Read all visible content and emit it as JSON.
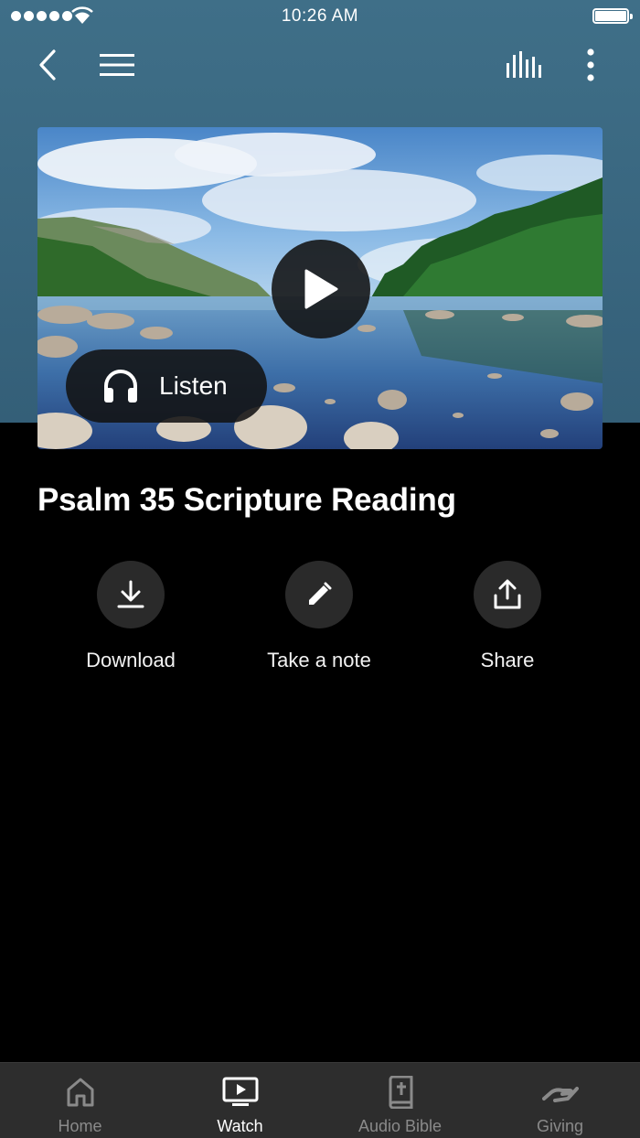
{
  "status_bar": {
    "time": "10:26 AM"
  },
  "toolbar": {
    "back_icon": "chevron-left-icon",
    "menu_icon": "hamburger-menu-icon",
    "audio_icon": "equalizer-icon",
    "more_icon": "more-vertical-icon"
  },
  "hero": {
    "image": "lake-landscape",
    "play_icon": "play-icon",
    "listen_icon": "headphones-icon",
    "listen_label": "Listen"
  },
  "title": "Psalm 35 Scripture Reading",
  "actions": [
    {
      "label": "Download",
      "icon": "download-icon"
    },
    {
      "label": "Take a note",
      "icon": "pencil-icon"
    },
    {
      "label": "Share",
      "icon": "share-icon"
    }
  ],
  "tabs": [
    {
      "label": "Home",
      "icon": "home-icon",
      "active": false
    },
    {
      "label": "Watch",
      "icon": "tv-play-icon",
      "active": true
    },
    {
      "label": "Audio Bible",
      "icon": "bible-icon",
      "active": false
    },
    {
      "label": "Giving",
      "icon": "giving-hand-icon",
      "active": false
    }
  ],
  "colors": {
    "header_bg": "#3f6f88",
    "background": "#000000",
    "tab_bar": "#2d2d2d",
    "tab_active": "#ffffff",
    "tab_inactive": "#8a8a8a"
  }
}
